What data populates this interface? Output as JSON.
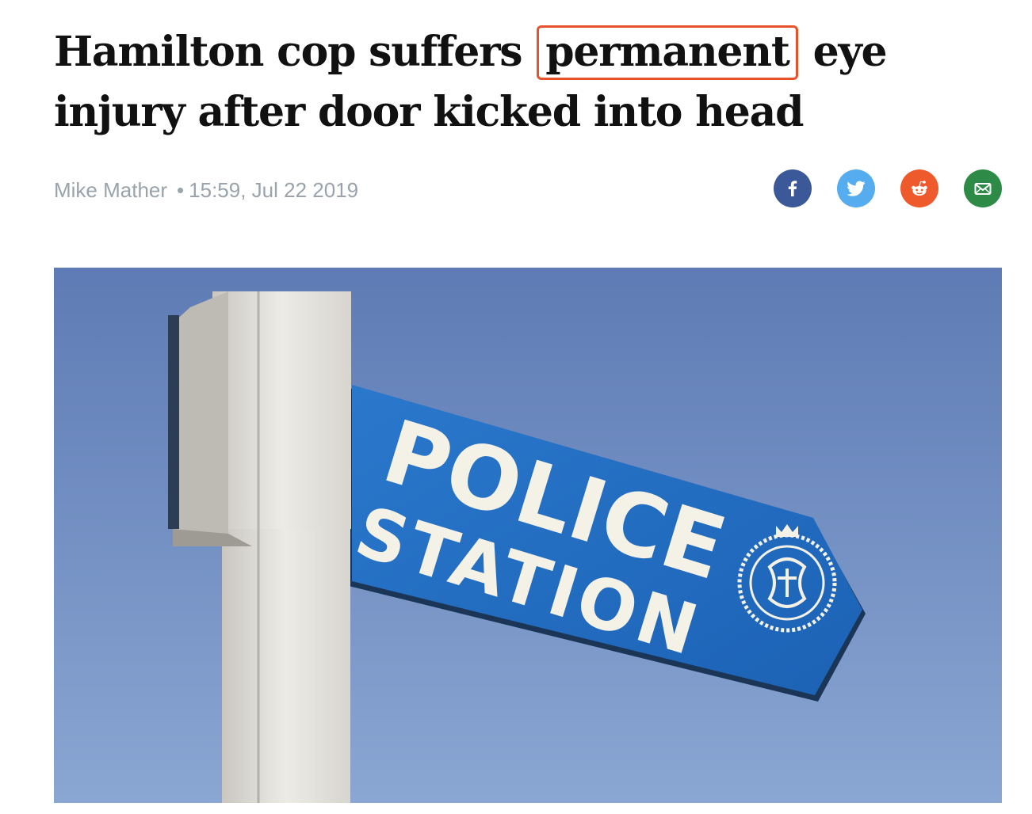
{
  "article": {
    "headline_before": "Hamilton cop suffers",
    "headline_highlight": "permanent",
    "headline_after": "eye injury after door kicked into head",
    "author": "Mike Mather",
    "separator": "•",
    "timestamp": "15:59, Jul 22 2019"
  },
  "share_buttons": [
    {
      "name": "facebook",
      "icon": "facebook-icon",
      "color": "#3b5998"
    },
    {
      "name": "twitter",
      "icon": "twitter-icon",
      "color": "#55acee"
    },
    {
      "name": "reddit",
      "icon": "reddit-icon",
      "color": "#ef5a2c"
    },
    {
      "name": "email",
      "icon": "email-icon",
      "color": "#2e8b47"
    }
  ],
  "hero_image": {
    "sign_line1": "POLICE",
    "sign_line2": "STATION"
  },
  "colors": {
    "highlight_border": "#e8522b",
    "sky": "#6f8fc0",
    "sign_blue": "#1f6fc4",
    "byline_text": "#9aa3ab"
  }
}
